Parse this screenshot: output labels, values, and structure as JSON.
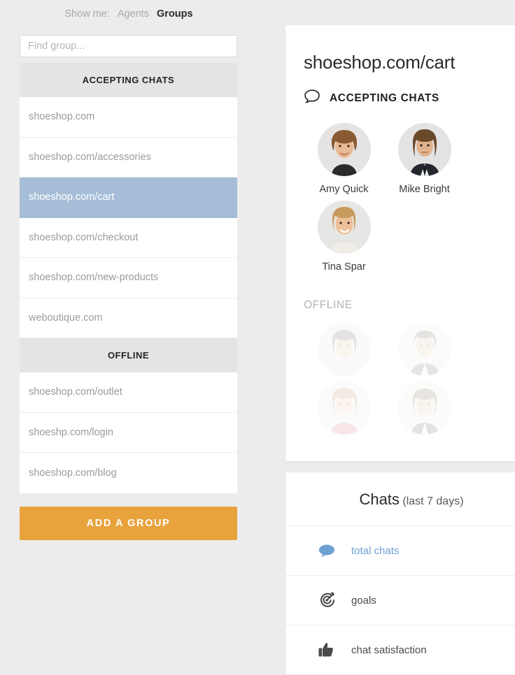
{
  "topbar": {
    "label": "Show me:",
    "options": [
      {
        "text": "Agents",
        "active": false
      },
      {
        "text": "Groups",
        "active": true
      }
    ]
  },
  "sidebar": {
    "search": {
      "placeholder": "Find group...",
      "value": ""
    },
    "sections": [
      {
        "header": "ACCEPTING CHATS",
        "items": [
          {
            "name": "shoeshop.com",
            "selected": false
          },
          {
            "name": "shoeshop.com/accessories",
            "selected": false
          },
          {
            "name": "shoeshop.com/cart",
            "selected": true
          },
          {
            "name": "shoeshop.com/checkout",
            "selected": false
          },
          {
            "name": "shoeshop.com/new-products",
            "selected": false
          },
          {
            "name": "weboutique.com",
            "selected": false
          }
        ]
      },
      {
        "header": "OFFLINE",
        "items": [
          {
            "name": "shoeshop.com/outlet",
            "selected": false
          },
          {
            "name": "shoeshp.com/login",
            "selected": false
          },
          {
            "name": "shoeshop.com/blog",
            "selected": false
          }
        ]
      }
    ],
    "add_button": "ADD A GROUP"
  },
  "detail": {
    "title": "shoeshop.com/cart",
    "accepting": {
      "icon": "chat-bubble-icon",
      "label": "ACCEPTING CHATS",
      "agents": [
        {
          "name": "Amy Quick",
          "avatar": "female-curly-hair"
        },
        {
          "name": "Mike Bright",
          "avatar": "male-long-hair-suit"
        },
        {
          "name": "Tina Spar",
          "avatar": "female-blonde"
        }
      ]
    },
    "offline": {
      "label": "OFFLINE",
      "agents": [
        {
          "name": "",
          "avatar": "male-dark-hair"
        },
        {
          "name": "",
          "avatar": "male-short-hair-suit"
        },
        {
          "name": "",
          "avatar": "female-red-top"
        },
        {
          "name": "",
          "avatar": "female-dark-hair"
        }
      ]
    }
  },
  "stats": {
    "title": "Chats",
    "subtitle": "(last 7 days)",
    "rows": [
      {
        "icon": "chat-bubble-filled-icon",
        "label": "total chats",
        "tone": "blue"
      },
      {
        "icon": "target-goal-icon",
        "label": "goals",
        "tone": "dark"
      },
      {
        "icon": "thumbs-up-icon",
        "label": "chat satisfaction",
        "tone": "dark"
      }
    ]
  },
  "colors": {
    "page_background": "#ececec",
    "selected_row": "#a5bdd7",
    "add_button": "#e8a33d",
    "stat_link": "#6ea0d2",
    "section_header_bg": "#e4e4e4"
  }
}
